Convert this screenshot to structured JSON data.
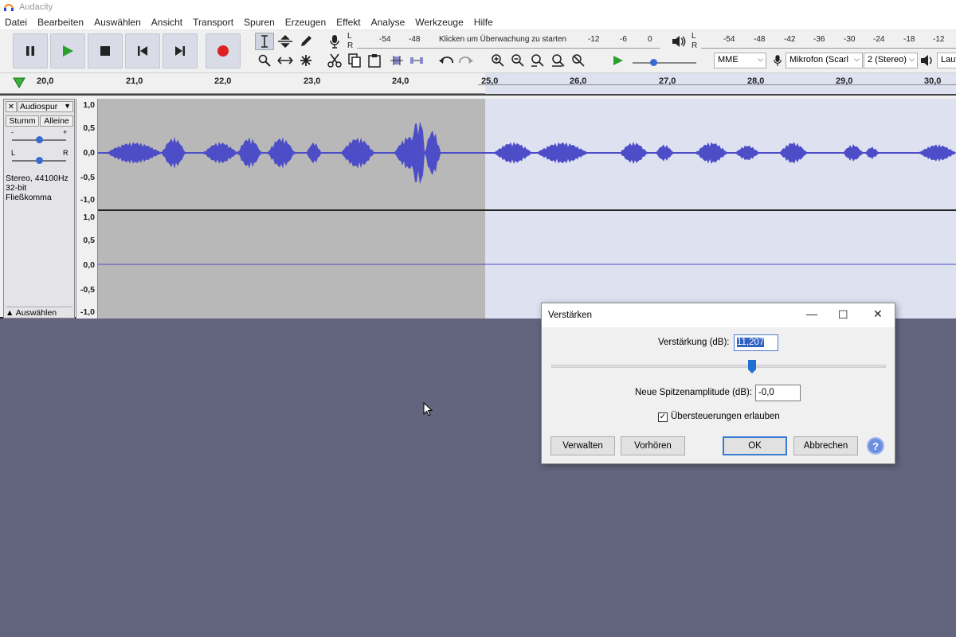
{
  "window": {
    "title": "Audacity"
  },
  "menu": [
    "Datei",
    "Bearbeiten",
    "Auswählen",
    "Ansicht",
    "Transport",
    "Spuren",
    "Erzeugen",
    "Effekt",
    "Analyse",
    "Werkzeuge",
    "Hilfe"
  ],
  "meter": {
    "record_ticks": [
      "-54",
      "-48",
      "Klicken um Überwachung zu starten",
      "-12",
      "-6",
      "0"
    ],
    "playback_ticks": [
      "-54",
      "-48",
      "-42",
      "-36",
      "-30",
      "-24",
      "-18",
      "-12"
    ],
    "lr": [
      "L",
      "R"
    ]
  },
  "device": {
    "host": "MME",
    "mic": "Mikrofon (Scarl",
    "channels": "2 (Stereo)",
    "speaker": "Laut"
  },
  "ruler": [
    "20,0",
    "21,0",
    "22,0",
    "23,0",
    "24,0",
    "25,0",
    "26,0",
    "27,0",
    "28,0",
    "29,0",
    "30,0"
  ],
  "track": {
    "name": "Audiospur",
    "mute": "Stumm",
    "solo": "Alleine",
    "gain_min": "-",
    "gain_max": "+",
    "pan_left": "L",
    "pan_right": "R",
    "info1": "Stereo, 44100Hz",
    "info2": "32-bit Fließkomma",
    "select": "Auswählen",
    "close": "✕",
    "collapse": "▲",
    "menu_arrow": "▼"
  },
  "vscale": [
    "1,0",
    "0,5",
    "0,0",
    "-0,5",
    "-1,0"
  ],
  "dialog": {
    "title": "Verstärken",
    "amp_label": "Verstärkung (dB):",
    "amp_value": "11,207",
    "slider_fraction": 0.6,
    "peak_label": "Neue Spitzenamplitude (dB):",
    "peak_value": "-0,0",
    "clip_label": "Übersteuerungen erlauben",
    "clip_checked": true,
    "manage": "Verwalten",
    "preview": "Vorhören",
    "ok": "OK",
    "cancel": "Abbrechen",
    "help": "?"
  },
  "colors": {
    "wave": "#4d4dc8",
    "selection": "#b8b8b8",
    "background": "#63657f",
    "wave_bg": "#dde1f0"
  }
}
